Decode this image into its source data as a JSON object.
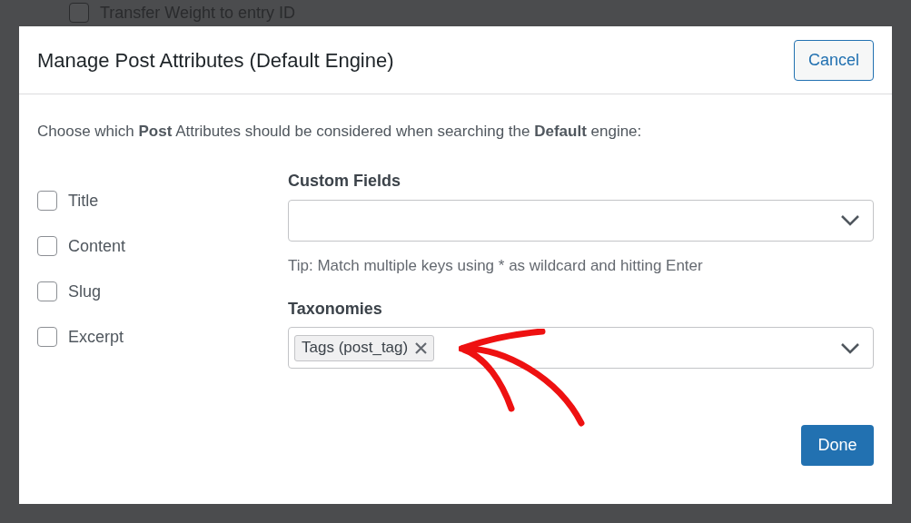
{
  "background": {
    "checkbox_label": "Transfer Weight to entry ID",
    "checked": false
  },
  "dialog": {
    "title": "Manage Post Attributes (Default Engine)",
    "cancel_button": "Cancel",
    "intro": "Choose which **Post** Attributes should be considered when searching the **Default** engine:",
    "attributes": [
      {
        "label": "Title",
        "checked": false
      },
      {
        "label": "Content",
        "checked": false
      },
      {
        "label": "Slug",
        "checked": false
      },
      {
        "label": "Excerpt",
        "checked": false
      }
    ],
    "custom_fields": {
      "label": "Custom Fields",
      "tip": "Tip: Match multiple keys using * as wildcard and hitting Enter"
    },
    "taxonomies": {
      "label": "Taxonomies",
      "tags": [
        "Tags (post_tag)"
      ]
    },
    "done_button": "Done"
  }
}
